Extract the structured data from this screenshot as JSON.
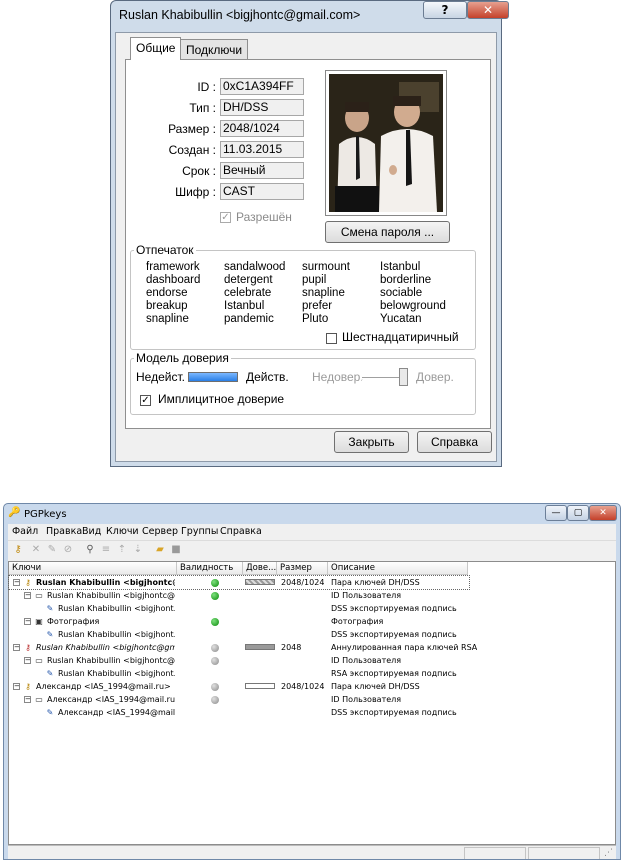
{
  "dialog": {
    "title": "Ruslan Khabibullin <bigjhontc@gmail.com>",
    "help_btn": "?",
    "close_btn": "✕",
    "tabs": [
      "Общие",
      "Подключи"
    ],
    "fields": [
      {
        "label": "ID :",
        "value": "0xC1A394FF"
      },
      {
        "label": "Тип :",
        "value": "DH/DSS"
      },
      {
        "label": "Размер :",
        "value": "2048/1024"
      },
      {
        "label": "Создан :",
        "value": "11.03.2015"
      },
      {
        "label": "Срок :",
        "value": "Вечный"
      },
      {
        "label": "Шифр :",
        "value": "CAST"
      }
    ],
    "enabled_label": "Разрешён",
    "change_password": "Смена пароля ...",
    "fingerprint": {
      "title": "Отпечаток",
      "words": [
        "framework",
        "sandalwood",
        "surmount",
        "Istanbul",
        "dashboard",
        "detergent",
        "pupil",
        "borderline",
        "endorse",
        "celebrate",
        "snapline",
        "sociable",
        "breakup",
        "Istanbul",
        "prefer",
        "belowground",
        "snapline",
        "pandemic",
        "Pluto",
        "Yucatan"
      ],
      "hex_label": "Шестнадцатиричный"
    },
    "trust": {
      "title": "Модель доверия",
      "invalid": "Недейст.",
      "valid": "Действ.",
      "untrusted": "Недовер.",
      "trusted": "Довер.",
      "validity_fraction": 1.0,
      "trust_fraction": 0.9,
      "implicit_label": "Имплицитное доверие",
      "implicit_checked": true
    },
    "close_label": "Закрыть",
    "help_label": "Справка"
  },
  "pgpkeys": {
    "title": "PGPkeys",
    "menu": [
      "Файл",
      "Правка",
      "Вид",
      "Ключи",
      "Сервер",
      "Группы",
      "Справка"
    ],
    "columns": [
      "Ключи",
      "Валидность",
      "Дове...",
      "Размер",
      "Описание"
    ],
    "rows": [
      {
        "level": 0,
        "exp": "−",
        "icon": "keypair-icon",
        "name": "Ruslan Khabibullin <bigjhontc@g...",
        "bold": true,
        "validity": "green",
        "trust": "hatched",
        "size": "2048/1024",
        "desc": "Пара ключей DH/DSS"
      },
      {
        "level": 1,
        "exp": "−",
        "icon": "userid-icon",
        "name": "Ruslan Khabibullin <bigjhontc@...",
        "validity": "green",
        "size": "",
        "desc": "ID Пользователя"
      },
      {
        "level": 2,
        "exp": "",
        "icon": "signature-icon",
        "name": "Ruslan Khabibullin <bigjhont...",
        "validity": "",
        "size": "",
        "desc": "DSS экспортируемая подпись"
      },
      {
        "level": 1,
        "exp": "−",
        "icon": "photo-icon",
        "name": "Фотография",
        "validity": "green",
        "size": "",
        "desc": "Фотография"
      },
      {
        "level": 2,
        "exp": "",
        "icon": "signature-icon",
        "name": "Ruslan Khabibullin <bigjhont...",
        "validity": "",
        "size": "",
        "desc": "DSS экспортируемая подпись"
      },
      {
        "level": 0,
        "exp": "−",
        "icon": "revoked-keypair-icon",
        "name": "Ruslan Khabibullin <bigjhontc@gm...",
        "italic": true,
        "validity": "gray",
        "trust": "gray",
        "size": "2048",
        "desc": "Аннулированная пара ключей RSA"
      },
      {
        "level": 1,
        "exp": "−",
        "icon": "userid-icon",
        "name": "Ruslan Khabibullin <bigjhontc@...",
        "validity": "gray",
        "size": "",
        "desc": "ID Пользователя"
      },
      {
        "level": 2,
        "exp": "",
        "icon": "signature-icon",
        "name": "Ruslan Khabibullin <bigjhont...",
        "validity": "",
        "size": "",
        "desc": "RSA экспортируемая подпись"
      },
      {
        "level": 0,
        "exp": "−",
        "icon": "keypair-icon",
        "name": "Александр <IAS_1994@mail.ru>",
        "validity": "gray",
        "trust": "empty",
        "size": "2048/1024",
        "desc": "Пара ключей DH/DSS"
      },
      {
        "level": 1,
        "exp": "−",
        "icon": "userid-icon",
        "name": "Александр <IAS_1994@mail.ru>",
        "validity": "gray",
        "size": "",
        "desc": "ID Пользователя"
      },
      {
        "level": 2,
        "exp": "",
        "icon": "signature-icon",
        "name": "Александр <IAS_1994@mail....",
        "validity": "",
        "size": "",
        "desc": "DSS экспортируемая подпись"
      }
    ]
  }
}
